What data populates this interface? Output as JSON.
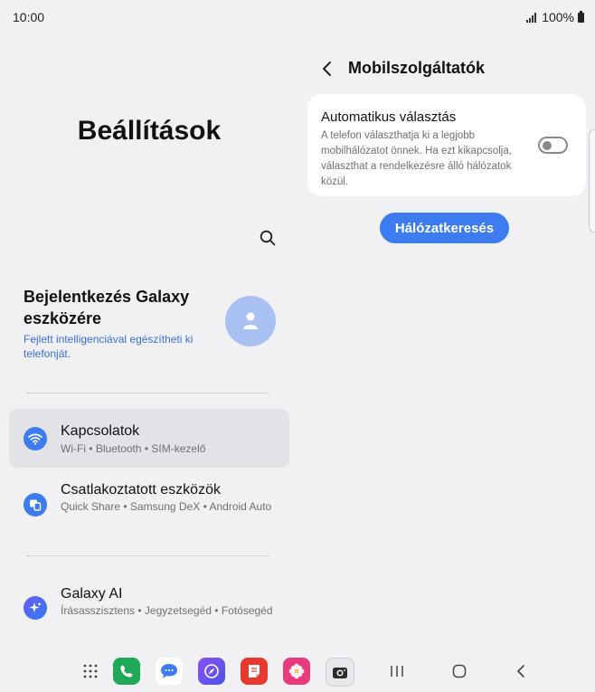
{
  "status_bar": {
    "time": "10:00",
    "battery": "100%"
  },
  "left_pane": {
    "title": "Beállítások",
    "account": {
      "title": "Bejelentkezés Galaxy eszközére",
      "subtitle": "Fejlett intelligenciával egészítheti ki telefonját."
    },
    "items": [
      {
        "title": "Kapcsolatok",
        "subtitle": "Wi-Fi • Bluetooth • SIM-kezelő",
        "icon": "wifi-icon",
        "color": "#3d7bf0"
      },
      {
        "title": "Csatlakoztatott eszközök",
        "subtitle": "Quick Share • Samsung DeX • Android Auto",
        "icon": "devices-icon",
        "color": "#3d7bf0"
      },
      {
        "title": "Galaxy AI",
        "subtitle": "Írásasszisztens • Jegyzetsegéd • Fotósegéd",
        "icon": "sparkle-icon",
        "color": "#4a5fe8"
      }
    ]
  },
  "right_pane": {
    "title": "Mobilszolgáltatók",
    "auto_select": {
      "title": "Automatikus választás",
      "description": "A telefon választhatja ki a legjobb mobilhálózatot önnek. Ha ezt kikapcsolja, választhat a rendelkezésre álló hálózatok közül.",
      "enabled": false
    },
    "search_button": "Hálózatkeresés"
  },
  "colors": {
    "accent": "#3d7bf0",
    "background": "#f1f1f4"
  }
}
